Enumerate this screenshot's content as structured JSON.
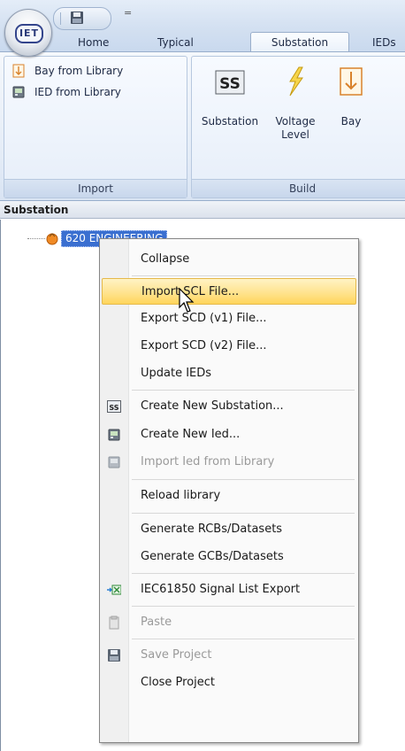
{
  "app": {
    "orb_label": "IET",
    "qat_more": "="
  },
  "ribbon": {
    "tabs": [
      {
        "label": "Home"
      },
      {
        "label": "Typical"
      },
      {
        "label": "Substation"
      },
      {
        "label": "IEDs"
      }
    ],
    "active_tab": "Substation",
    "groups": {
      "import": {
        "label": "Import",
        "items": [
          {
            "label": "Bay from Library",
            "icon": "bay-icon"
          },
          {
            "label": "IED from Library",
            "icon": "ied-icon"
          }
        ]
      },
      "build": {
        "label": "Build",
        "items": [
          {
            "label": "Substation",
            "icon": "substation-icon"
          },
          {
            "label": "Voltage Level",
            "label_line1": "Voltage",
            "label_line2": "Level",
            "icon": "lightning-icon"
          },
          {
            "label": "Bay",
            "icon": "bay-icon"
          }
        ]
      }
    }
  },
  "panel": {
    "title": "Substation",
    "tree_root": "620 ENGINEERING"
  },
  "context_menu": {
    "items": [
      {
        "label": "Collapse",
        "enabled": true,
        "icon": null
      },
      {
        "label": "Import SCL File...",
        "enabled": true,
        "highlighted": true,
        "icon": null
      },
      {
        "label": "Export SCD (v1) File...",
        "enabled": true,
        "icon": null
      },
      {
        "label": "Export SCD (v2) File...",
        "enabled": true,
        "icon": null
      },
      {
        "label": "Update IEDs",
        "enabled": true,
        "icon": null
      },
      {
        "label": "Create New Substation...",
        "enabled": true,
        "icon": "substation-icon"
      },
      {
        "label": "Create New Ied...",
        "enabled": true,
        "icon": "ied-icon"
      },
      {
        "label": "Import Ied from Library",
        "enabled": false,
        "icon": "ied-icon"
      },
      {
        "label": "Reload library",
        "enabled": true,
        "icon": null
      },
      {
        "label": "Generate RCBs/Datasets",
        "enabled": true,
        "icon": null
      },
      {
        "label": "Generate GCBs/Datasets",
        "enabled": true,
        "icon": null
      },
      {
        "label": "IEC61850 Signal List Export",
        "enabled": true,
        "icon": "excel-export-icon"
      },
      {
        "label": "Paste",
        "enabled": false,
        "icon": "clipboard-icon"
      },
      {
        "label": "Save Project",
        "enabled": false,
        "icon": "save-icon"
      },
      {
        "label": "Close Project",
        "enabled": true,
        "icon": null
      }
    ]
  },
  "colors": {
    "ribbon_bg": "#dfe9f5",
    "selection": "#3a6fd0",
    "menu_hover": "#ffe28a"
  }
}
